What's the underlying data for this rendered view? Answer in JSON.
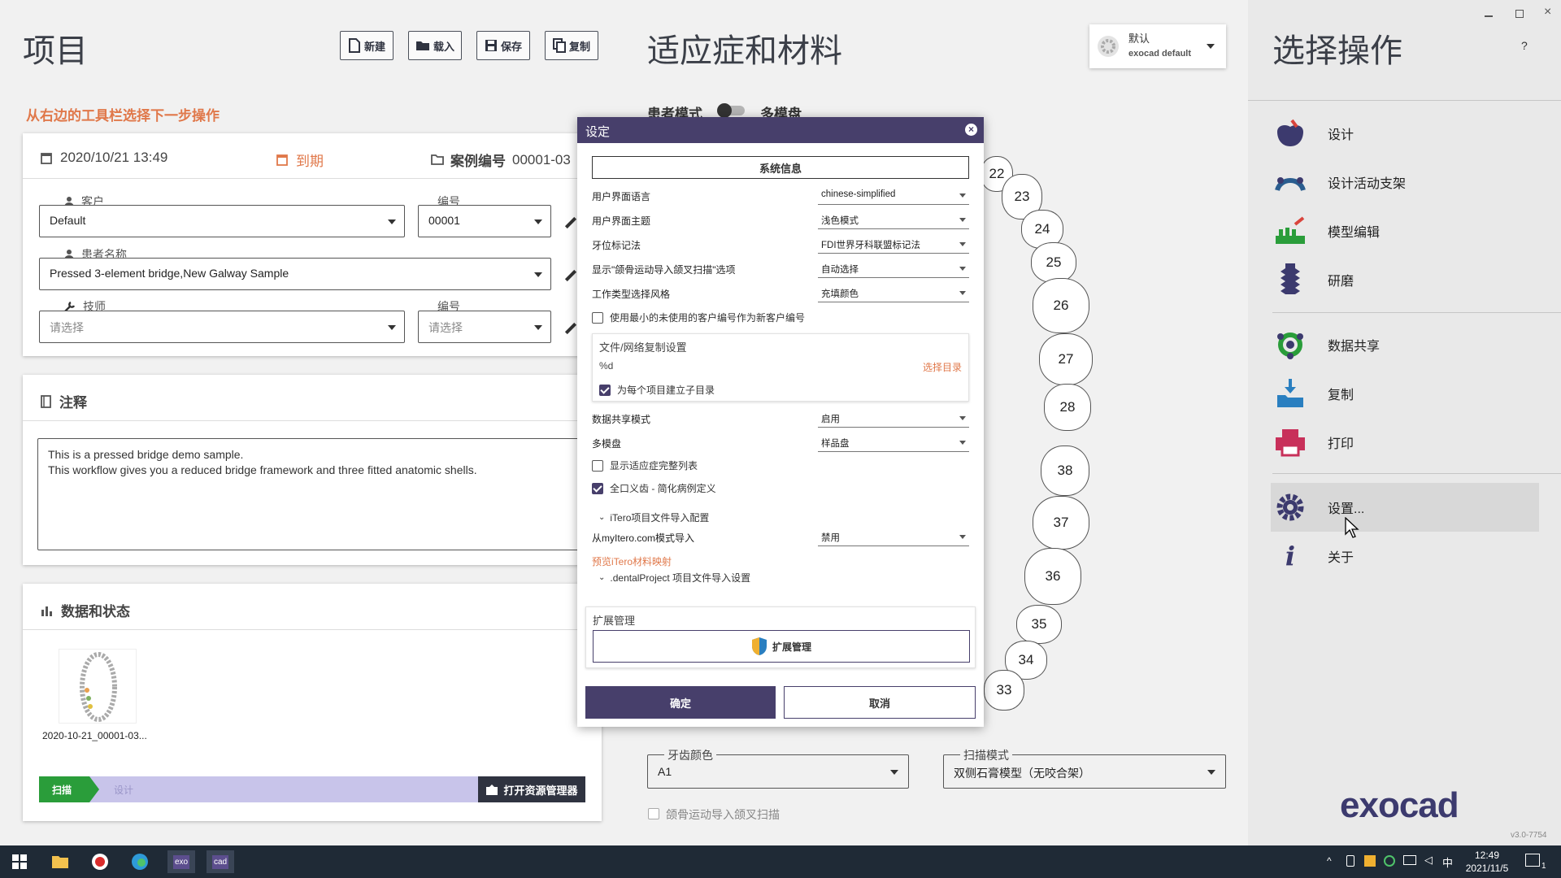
{
  "window": {
    "version": "v3.0-7754",
    "help_label": "?"
  },
  "project": {
    "title": "项目",
    "toolbar": {
      "new": "新建",
      "load": "载入",
      "save": "保存",
      "copy": "复制"
    },
    "hint": "从右边的工具栏选择下一步操作",
    "date": "2020/10/21 13:49",
    "due_label": "到期",
    "case_label": "案例编号",
    "case_number": "00001-03",
    "client_label": "客户",
    "client_value": "Default",
    "client_no_label": "编号",
    "client_no_value": "00001",
    "patient_label": "患者名称",
    "patient_value": "Pressed 3-element bridge,New Galway Sample",
    "tech_label": "技师",
    "tech_placeholder": "请选择",
    "tech_no_label": "编号",
    "tech_no_placeholder": "请选择"
  },
  "notes": {
    "title": "注释",
    "line1": "This is a pressed bridge demo sample.",
    "line2": "This workflow gives you a reduced bridge framework and three fitted anatomic shells."
  },
  "data_status": {
    "title": "数据和状态",
    "thumb_caption": "2020-10-21_00001-03...",
    "step_scan": "扫描",
    "step_design": "设计",
    "open_explorer": "打开资源管理器"
  },
  "indications": {
    "title": "适应症和材料",
    "profile_name": "默认",
    "profile_sub": "exocad default",
    "patient_mode": "患者模式",
    "multi_die": "多模盘",
    "teeth_upper": [
      "22",
      "23",
      "24",
      "25",
      "26",
      "27",
      "28"
    ],
    "teeth_lower": [
      "38",
      "37",
      "36",
      "35",
      "34",
      "33"
    ],
    "tooth_color_label": "牙齿颜色",
    "tooth_color_value": "A1",
    "scan_mode_label": "扫描模式",
    "scan_mode_value": "双侧石膏模型（无咬合架）",
    "jaw_motion_label": "颌骨运动导入颌叉扫描"
  },
  "actions": {
    "title": "选择操作",
    "items": [
      "设计",
      "设计活动支架",
      "模型编辑",
      "研磨",
      "数据共享",
      "复制",
      "打印",
      "设置...",
      "关于"
    ],
    "brand": "exocad"
  },
  "settings_dialog": {
    "title": "设定",
    "system_info": "系统信息",
    "rows": [
      {
        "label": "用户界面语言",
        "value": "chinese-simplified"
      },
      {
        "label": "用户界面主题",
        "value": "浅色模式"
      },
      {
        "label": "牙位标记法",
        "value": "FDI世界牙科联盟标记法"
      },
      {
        "label": "显示\"颌骨运动导入颌叉扫描\"选项",
        "value": "自动选择"
      },
      {
        "label": "工作类型选择风格",
        "value": "充填颜色"
      }
    ],
    "use_min_client_no": "使用最小的未使用的客户编号作为新客户编号",
    "file_copy_title": "文件/网络复制设置",
    "file_copy_path": "%d",
    "choose_dir": "选择目录",
    "subdir_per_project": "为每个项目建立子目录",
    "data_share_label": "数据共享模式",
    "data_share_value": "启用",
    "multi_die_label": "多模盘",
    "multi_die_value": "样品盘",
    "show_full_list": "显示适应症完整列表",
    "full_arch": "全口义齿 - 简化病例定义",
    "itero_config": "iTero项目文件导入配置",
    "mytero_label": "从myItero.com模式导入",
    "mytero_value": "禁用",
    "itero_mapping": "预览iTero材料映射",
    "dental_project": ".dentalProject 项目文件导入设置",
    "ext_title": "扩展管理",
    "ext_button": "扩展管理",
    "ok": "确定",
    "cancel": "取消"
  },
  "taskbar": {
    "time": "12:49",
    "date": "2021/11/5",
    "ime": "中",
    "notif_count": "1"
  }
}
